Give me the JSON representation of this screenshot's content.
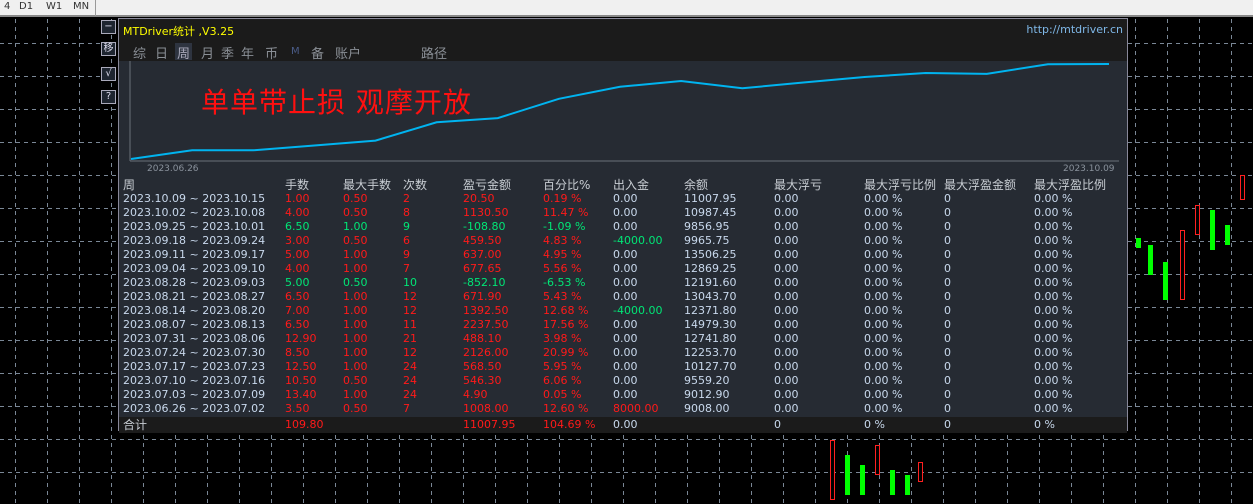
{
  "timeframes": [
    "4",
    "D1",
    "W1",
    "MN"
  ],
  "side_buttons": [
    {
      "label": "−",
      "icon": "minimize-icon"
    },
    {
      "label": "移",
      "icon": "move-icon"
    },
    {
      "label": "√",
      "icon": "check-icon"
    },
    {
      "label": "?",
      "icon": "help-icon"
    }
  ],
  "window": {
    "title": "MTDriver统计 ,V3.25",
    "url": "http://mtdriver.cn"
  },
  "tabs": [
    {
      "label": "综",
      "active": false
    },
    {
      "label": "日",
      "active": false
    },
    {
      "label": "周",
      "active": true
    },
    {
      "label": "月",
      "active": false
    },
    {
      "label": "季",
      "active": false
    },
    {
      "label": "年",
      "active": false
    },
    {
      "label": "币",
      "active": false
    },
    {
      "label": "M",
      "active": false
    },
    {
      "label": "备",
      "active": false
    },
    {
      "label": "账户",
      "active": false
    },
    {
      "label": "路径",
      "active": false
    }
  ],
  "chart": {
    "slogan": "单单带止损  观摩开放",
    "start_label": "2023.06.26",
    "end_label": "2023.10.09",
    "line_color": "#00b4f0"
  },
  "colors": {
    "profit": "#ff1a1a",
    "loss": "#00e676",
    "neutral": "#c8d8ec"
  },
  "table": {
    "headers": [
      "周",
      "手数",
      "最大手数",
      "次数",
      "盈亏金额",
      "百分比%",
      "出入金",
      "余额",
      "最大浮亏",
      "最大浮亏比例",
      "最大浮盈金额",
      "最大浮盈比例"
    ],
    "rows": [
      [
        "2023.10.09 ~ 2023.10.15",
        "1.00",
        "0.50",
        "2",
        "20.50",
        "0.19 %",
        "0.00",
        "11007.95",
        "0.00",
        "0.00 %",
        "0",
        "0.00 %"
      ],
      [
        "2023.10.02 ~ 2023.10.08",
        "4.00",
        "0.50",
        "8",
        "1130.50",
        "11.47 %",
        "0.00",
        "10987.45",
        "0.00",
        "0.00 %",
        "0",
        "0.00 %"
      ],
      [
        "2023.09.25 ~ 2023.10.01",
        "6.50",
        "1.00",
        "9",
        "-108.80",
        "-1.09 %",
        "0.00",
        "9856.95",
        "0.00",
        "0.00 %",
        "0",
        "0.00 %"
      ],
      [
        "2023.09.18 ~ 2023.09.24",
        "3.00",
        "0.50",
        "6",
        "459.50",
        "4.83 %",
        "-4000.00",
        "9965.75",
        "0.00",
        "0.00 %",
        "0",
        "0.00 %"
      ],
      [
        "2023.09.11 ~ 2023.09.17",
        "5.00",
        "1.00",
        "9",
        "637.00",
        "4.95 %",
        "0.00",
        "13506.25",
        "0.00",
        "0.00 %",
        "0",
        "0.00 %"
      ],
      [
        "2023.09.04 ~ 2023.09.10",
        "4.00",
        "1.00",
        "7",
        "677.65",
        "5.56 %",
        "0.00",
        "12869.25",
        "0.00",
        "0.00 %",
        "0",
        "0.00 %"
      ],
      [
        "2023.08.28 ~ 2023.09.03",
        "5.00",
        "0.50",
        "10",
        "-852.10",
        "-6.53 %",
        "0.00",
        "12191.60",
        "0.00",
        "0.00 %",
        "0",
        "0.00 %"
      ],
      [
        "2023.08.21 ~ 2023.08.27",
        "6.50",
        "1.00",
        "12",
        "671.90",
        "5.43 %",
        "0.00",
        "13043.70",
        "0.00",
        "0.00 %",
        "0",
        "0.00 %"
      ],
      [
        "2023.08.14 ~ 2023.08.20",
        "7.00",
        "1.00",
        "12",
        "1392.50",
        "12.68 %",
        "-4000.00",
        "12371.80",
        "0.00",
        "0.00 %",
        "0",
        "0.00 %"
      ],
      [
        "2023.08.07 ~ 2023.08.13",
        "6.50",
        "1.00",
        "11",
        "2237.50",
        "17.56 %",
        "0.00",
        "14979.30",
        "0.00",
        "0.00 %",
        "0",
        "0.00 %"
      ],
      [
        "2023.07.31 ~ 2023.08.06",
        "12.90",
        "1.00",
        "21",
        "488.10",
        "3.98 %",
        "0.00",
        "12741.80",
        "0.00",
        "0.00 %",
        "0",
        "0.00 %"
      ],
      [
        "2023.07.24 ~ 2023.07.30",
        "8.50",
        "1.00",
        "12",
        "2126.00",
        "20.99 %",
        "0.00",
        "12253.70",
        "0.00",
        "0.00 %",
        "0",
        "0.00 %"
      ],
      [
        "2023.07.17 ~ 2023.07.23",
        "12.50",
        "1.00",
        "24",
        "568.50",
        "5.95 %",
        "0.00",
        "10127.70",
        "0.00",
        "0.00 %",
        "0",
        "0.00 %"
      ],
      [
        "2023.07.10 ~ 2023.07.16",
        "10.50",
        "0.50",
        "24",
        "546.30",
        "6.06 %",
        "0.00",
        "9559.20",
        "0.00",
        "0.00 %",
        "0",
        "0.00 %"
      ],
      [
        "2023.07.03 ~ 2023.07.09",
        "13.40",
        "1.00",
        "24",
        "4.90",
        "0.05 %",
        "0.00",
        "9012.90",
        "0.00",
        "0.00 %",
        "0",
        "0.00 %"
      ],
      [
        "2023.06.26 ~ 2023.07.02",
        "3.50",
        "0.50",
        "7",
        "1008.00",
        "12.60 %",
        "8000.00",
        "9008.00",
        "0.00",
        "0.00 %",
        "0",
        "0.00 %"
      ]
    ],
    "totals": [
      "合计",
      "109.80",
      "",
      "",
      "11007.95",
      "104.69 %",
      "0.00",
      "",
      "0",
      "0 %",
      "0",
      "0 %"
    ]
  }
}
